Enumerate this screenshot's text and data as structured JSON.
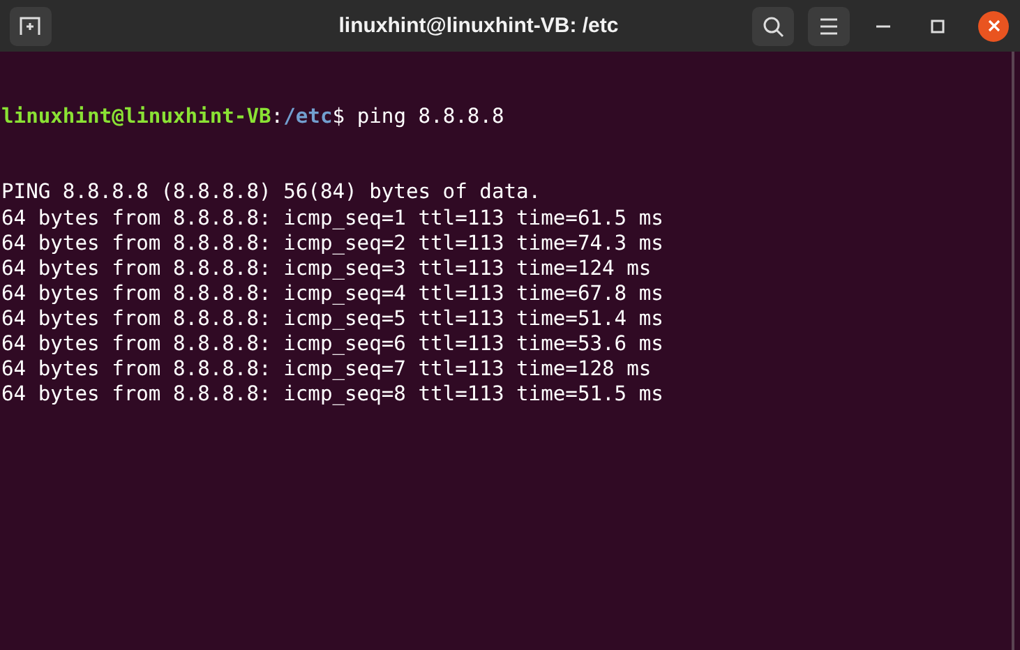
{
  "window": {
    "title": "linuxhint@linuxhint-VB: /etc"
  },
  "terminal": {
    "prompt": {
      "user_host": "linuxhint@linuxhint-VB",
      "separator": ":",
      "path": "/etc",
      "symbol": "$",
      "command": "ping 8.8.8.8"
    },
    "output": [
      "PING 8.8.8.8 (8.8.8.8) 56(84) bytes of data.",
      "64 bytes from 8.8.8.8: icmp_seq=1 ttl=113 time=61.5 ms",
      "64 bytes from 8.8.8.8: icmp_seq=2 ttl=113 time=74.3 ms",
      "64 bytes from 8.8.8.8: icmp_seq=3 ttl=113 time=124 ms",
      "64 bytes from 8.8.8.8: icmp_seq=4 ttl=113 time=67.8 ms",
      "64 bytes from 8.8.8.8: icmp_seq=5 ttl=113 time=51.4 ms",
      "64 bytes from 8.8.8.8: icmp_seq=6 ttl=113 time=53.6 ms",
      "64 bytes from 8.8.8.8: icmp_seq=7 ttl=113 time=128 ms",
      "64 bytes from 8.8.8.8: icmp_seq=8 ttl=113 time=51.5 ms"
    ]
  }
}
